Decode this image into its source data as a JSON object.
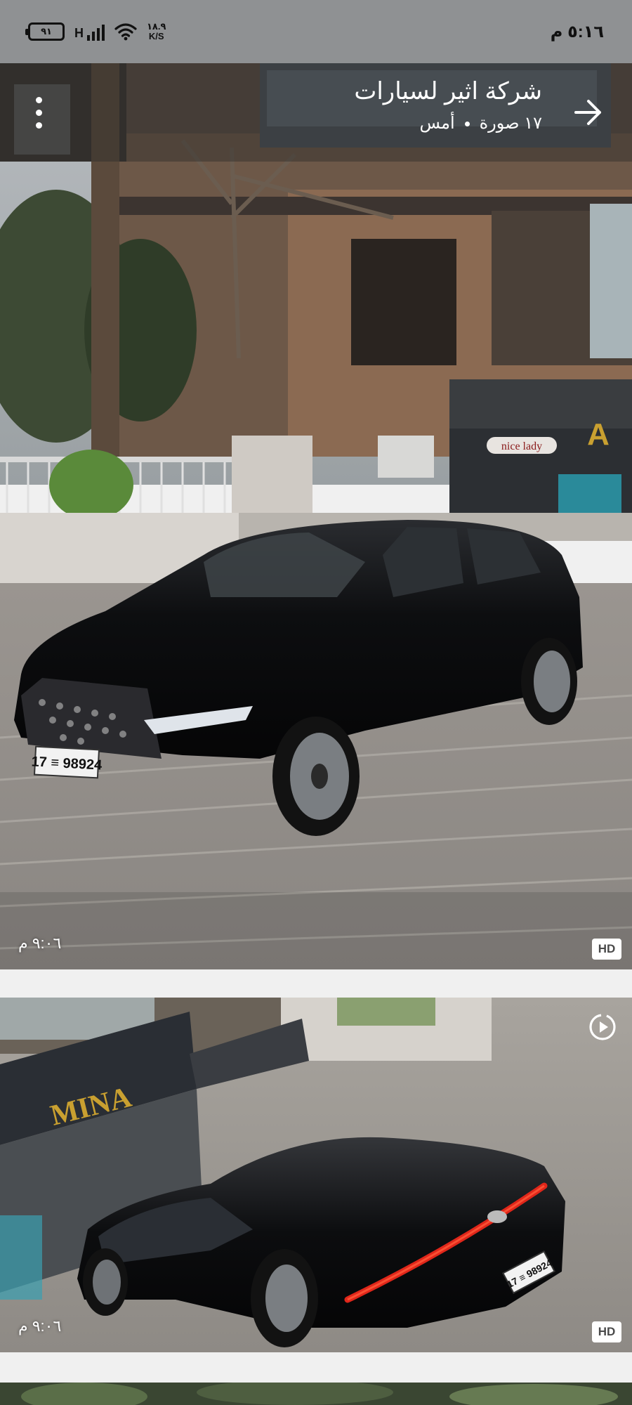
{
  "status_bar": {
    "time": "٥:١٦ م",
    "battery": "٩١",
    "network": "H",
    "speed_value": "١٨.٩",
    "speed_unit": "K/S"
  },
  "header": {
    "title": "شركة اثير لسيارات",
    "photo_count": "١٧ صورة",
    "date": "أمس"
  },
  "photos": [
    {
      "time": "٩:٠٦ م",
      "quality": "HD",
      "plate": "17 ≡ 98924",
      "shop_sign": "nice lady",
      "shop_letter": "A"
    },
    {
      "time": "٩:٠٦ م",
      "quality": "HD",
      "plate": "17 ≡ 98924",
      "shop_sign": "MINA"
    }
  ],
  "colors": {
    "status_bar_bg": "#8f9193",
    "header_overlay": "rgba(40,40,40,0.42)",
    "background": "#f0f0f0",
    "car_body": "#0b0b0c",
    "tail_light": "#e0261a"
  }
}
